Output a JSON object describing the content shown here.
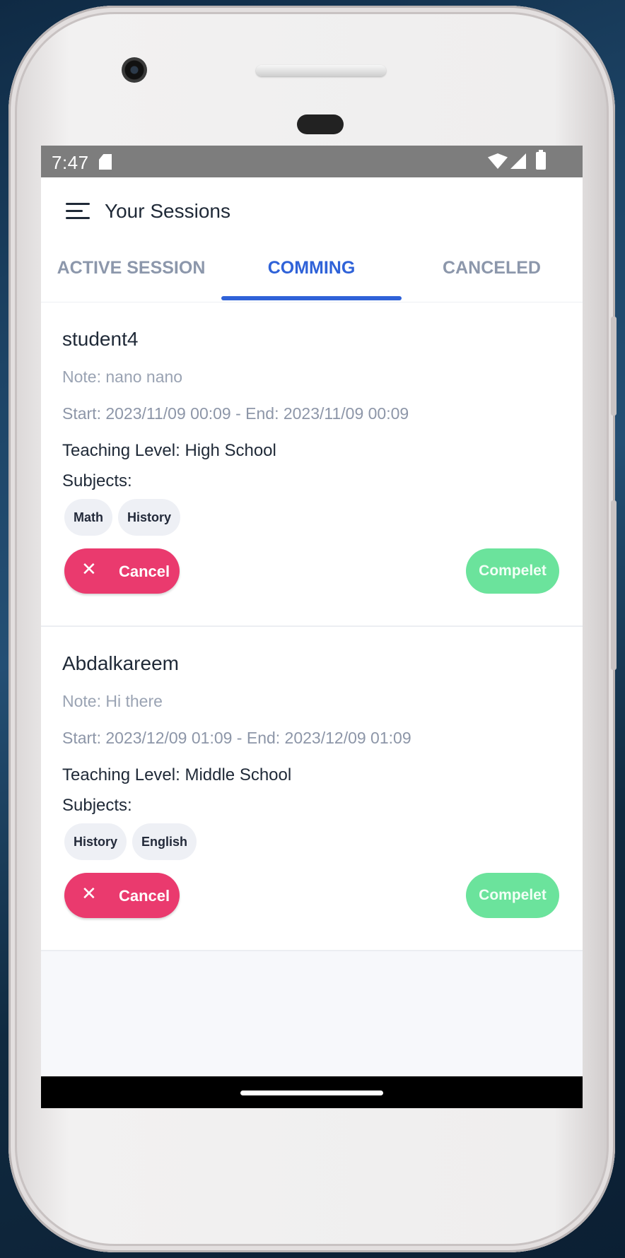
{
  "status_bar": {
    "time": "7:47"
  },
  "app_bar": {
    "title": "Your Sessions"
  },
  "tabs": [
    {
      "label": "ACTIVE SESSION",
      "active": false
    },
    {
      "label": "COMMING",
      "active": true
    },
    {
      "label": "CANCELED",
      "active": false
    }
  ],
  "sessions": [
    {
      "name": "student4",
      "note": "Note: nano nano",
      "dates": "Start: 2023/11/09 00:09 - End: 2023/11/09 00:09",
      "teaching_level": "Teaching Level: High School",
      "subjects_label": "Subjects:",
      "subjects": [
        "Math",
        "History"
      ],
      "cancel_label": "Cancel",
      "complete_label": "Compelet"
    },
    {
      "name": "Abdalkareem",
      "note": "Note: Hi there",
      "dates": "Start: 2023/12/09 01:09 - End: 2023/12/09 01:09",
      "teaching_level": "Teaching Level: Middle School",
      "subjects_label": "Subjects:",
      "subjects": [
        "History",
        "English"
      ],
      "cancel_label": "Cancel",
      "complete_label": "Compelet"
    }
  ],
  "colors": {
    "accent": "#2f62d8",
    "cancel": "#ea3a6e",
    "complete": "#6be39c"
  },
  "icons": {
    "menu": "menu-icon",
    "cancel": "close-icon",
    "status": [
      "sd-card-icon",
      "wifi-icon",
      "signal-icon",
      "battery-icon"
    ]
  }
}
